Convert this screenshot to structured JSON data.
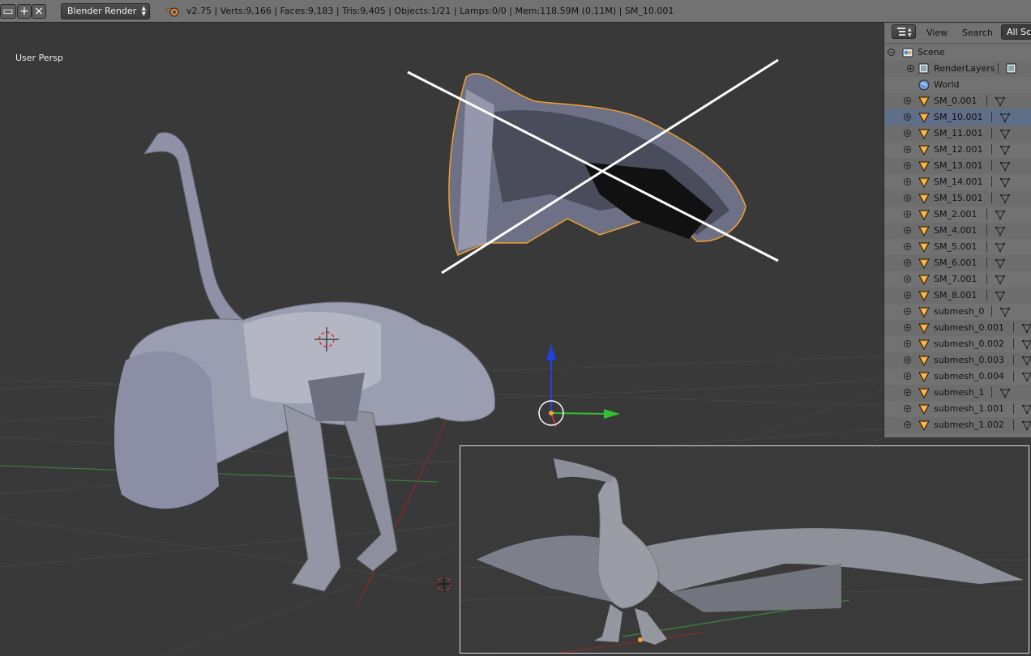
{
  "header": {
    "engine": "Blender Render",
    "stats": "v2.75 | Verts:9,166 | Faces:9,183 | Tris:9,405 | Objects:1/21 | Lamps:0/0 | Mem:118.59M (0.11M) | SM_10.001",
    "add_icon": "plus-icon",
    "close_icon": "close-icon",
    "logo_icon": "blender-logo-icon"
  },
  "viewport": {
    "label": "User Persp"
  },
  "outliner": {
    "view_label": "View",
    "search_label": "Search",
    "filter": "All Sce",
    "rows": [
      {
        "label": "Scene",
        "icon": "scene-icon",
        "expanded": true
      },
      {
        "label": "RenderLayers",
        "icon": "renderlayers-icon"
      },
      {
        "label": "World",
        "icon": "world-icon"
      },
      {
        "label": "SM_0.001",
        "icon": "mesh-object-icon"
      },
      {
        "label": "SM_10.001",
        "icon": "mesh-object-icon",
        "selected": true
      },
      {
        "label": "SM_11.001",
        "icon": "mesh-object-icon"
      },
      {
        "label": "SM_12.001",
        "icon": "mesh-object-icon"
      },
      {
        "label": "SM_13.001",
        "icon": "mesh-object-icon"
      },
      {
        "label": "SM_14.001",
        "icon": "mesh-object-icon"
      },
      {
        "label": "SM_15.001",
        "icon": "mesh-object-icon"
      },
      {
        "label": "SM_2.001",
        "icon": "mesh-object-icon"
      },
      {
        "label": "SM_4.001",
        "icon": "mesh-object-icon"
      },
      {
        "label": "SM_5.001",
        "icon": "mesh-object-icon"
      },
      {
        "label": "SM_6.001",
        "icon": "mesh-object-icon"
      },
      {
        "label": "SM_7.001",
        "icon": "mesh-object-icon"
      },
      {
        "label": "SM_8.001",
        "icon": "mesh-object-icon"
      },
      {
        "label": "submesh_0",
        "icon": "mesh-object-icon"
      },
      {
        "label": "submesh_0.001",
        "icon": "mesh-object-icon"
      },
      {
        "label": "submesh_0.002",
        "icon": "mesh-object-icon"
      },
      {
        "label": "submesh_0.003",
        "icon": "mesh-object-icon"
      },
      {
        "label": "submesh_0.004",
        "icon": "mesh-object-icon"
      },
      {
        "label": "submesh_1",
        "icon": "mesh-object-icon"
      },
      {
        "label": "submesh_1.001",
        "icon": "mesh-object-icon"
      },
      {
        "label": "submesh_1.002",
        "icon": "mesh-object-icon"
      }
    ]
  },
  "colors": {
    "header_bg": "#727272",
    "viewport_bg": "#393939",
    "selection_outline": "#f0a030",
    "selected_row": "#5f6e89",
    "axis_x": "#d03030",
    "axis_y": "#30c030",
    "axis_z": "#2040e0"
  }
}
